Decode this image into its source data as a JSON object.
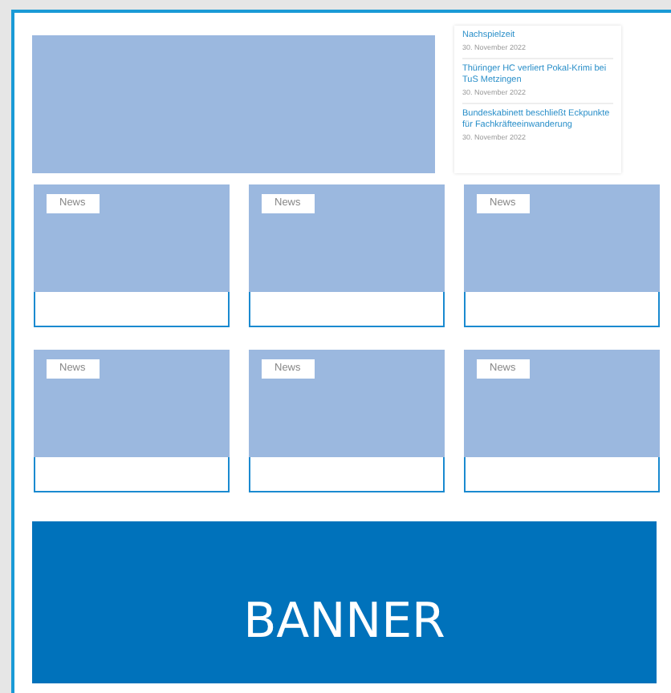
{
  "news_list": [
    {
      "title": "Nachspielzeit",
      "date": "30. November 2022"
    },
    {
      "title": "Thüringer HC verliert Pokal-Krimi bei TuS Metzingen",
      "date": "30. November 2022"
    },
    {
      "title": "Bundeskabinett beschließt Eckpunkte für Fachkräfteeinwanderung",
      "date": "30. November 2022"
    }
  ],
  "cards": [
    {
      "tag": "News"
    },
    {
      "tag": "News"
    },
    {
      "tag": "News"
    },
    {
      "tag": "News"
    },
    {
      "tag": "News"
    },
    {
      "tag": "News"
    }
  ],
  "banner": {
    "text": "BANNER"
  }
}
